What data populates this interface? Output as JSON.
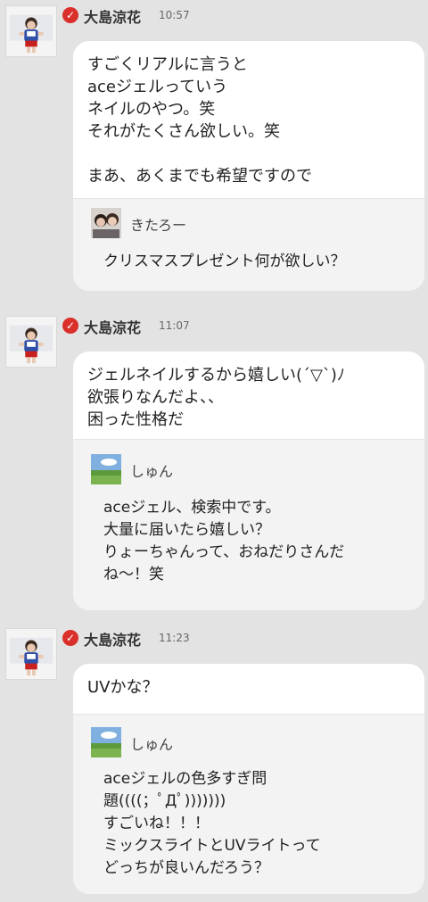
{
  "messages": [
    {
      "author": "大島涼花",
      "verified_icon": "check-circle-icon",
      "time": "10:57",
      "text": "すごくリアルに言うと\naceジェルっていう\nネイルのやつ。笑\nそれがたくさん欲しい。笑\n\nまあ、あくまでも希望ですので",
      "reply": {
        "author": "きたろー",
        "text": "クリスマスプレゼント何が欲しい？"
      }
    },
    {
      "author": "大島涼花",
      "verified_icon": "check-circle-icon",
      "time": "11:07",
      "text": "ジェルネイルするから嬉しい(´▽`)ﾉ\n欲張りなんだよ、、\n困った性格だ",
      "reply": {
        "author": "しゅん",
        "text": "aceジェル、検索中です。\n大量に届いたら嬉しい？\nりょーちゃんって、おねだりさんだ\nね～！笑"
      }
    },
    {
      "author": "大島涼花",
      "verified_icon": "check-circle-icon",
      "time": "11:23",
      "text": "UVかな？",
      "reply": {
        "author": "しゅん",
        "text": "aceジェルの色多すぎ問\n題((((；ﾟДﾟ)))))))\nすごいね！！！\nミックスライトとUVライトって\nどっちが良いんだろう？"
      }
    }
  ],
  "colors": {
    "background": "#e3e3e3",
    "bubble": "#ffffff",
    "reply_bg": "#f3f3f3",
    "verified": "#d9302b"
  }
}
